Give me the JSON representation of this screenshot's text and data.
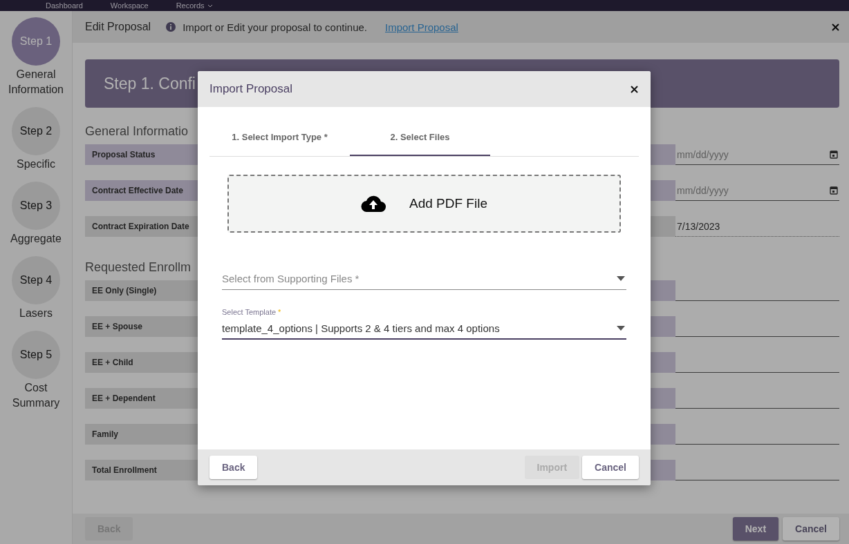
{
  "top_nav": {
    "items": [
      {
        "label": "Dashboard",
        "dropdown": false
      },
      {
        "label": "Workspace",
        "dropdown": false
      },
      {
        "label": "Records",
        "dropdown": true
      }
    ]
  },
  "steps": [
    {
      "label": "Step 1",
      "caption": "General Information",
      "selected": true
    },
    {
      "label": "Step 2",
      "caption": "Specific",
      "selected": false
    },
    {
      "label": "Step 3",
      "caption": "Aggregate",
      "selected": false
    },
    {
      "label": "Step 4",
      "caption": "Lasers",
      "selected": false
    },
    {
      "label": "Step 5",
      "caption": "Cost Summary",
      "selected": false
    }
  ],
  "header": {
    "title": "Edit Proposal",
    "message": "Import or Edit your proposal to continue.",
    "link": "Import Proposal"
  },
  "banner": {
    "title": "Step 1. Confi"
  },
  "sections": [
    {
      "heading": "General Informatio",
      "rows": [
        {
          "label": "Proposal Status",
          "readonly": false,
          "right_readonly": false,
          "right_field": {
            "kind": "date",
            "placeholder": "mm/dd/yyyy"
          }
        },
        {
          "label": "Contract Effective Date",
          "readonly": false,
          "right_readonly": false,
          "right_field": {
            "kind": "date",
            "placeholder": "mm/dd/yyyy"
          }
        },
        {
          "label": "Contract Expiration Date",
          "readonly": true,
          "right_readonly": true,
          "right_field": {
            "kind": "readonly",
            "value": "7/13/2023"
          }
        }
      ]
    },
    {
      "heading": "Requested Enrollm",
      "rows": [
        {
          "label": "EE Only (Single)",
          "readonly": true,
          "right_readonly": false,
          "right_field": {
            "kind": "text"
          }
        },
        {
          "label": "EE + Spouse",
          "readonly": true,
          "right_readonly": false,
          "right_field": {
            "kind": "text"
          }
        },
        {
          "label": "EE + Child",
          "readonly": true,
          "right_readonly": false,
          "right_field": {
            "kind": "text"
          }
        },
        {
          "label": "EE + Dependent",
          "readonly": true,
          "right_readonly": false,
          "right_field": {
            "kind": "text"
          }
        },
        {
          "label": "Family",
          "readonly": true,
          "right_readonly": false,
          "right_field": {
            "kind": "text"
          }
        },
        {
          "label": "Total Enrollment",
          "readonly": true,
          "right_readonly": false,
          "right_field": {
            "kind": "text"
          }
        }
      ]
    }
  ],
  "footer": {
    "buttons": [
      {
        "label": "Back",
        "kind": "secondary",
        "disabled": true
      },
      {
        "label": "Next",
        "kind": "primary",
        "disabled": false
      },
      {
        "label": "Cancel",
        "kind": "secondary",
        "disabled": false
      }
    ]
  },
  "modal": {
    "title": "Import Proposal",
    "tabs": [
      {
        "label": "1. Select Import Type *",
        "selected": false
      },
      {
        "label": "2. Select Files",
        "selected": true
      }
    ],
    "upload": {
      "label": "Add PDF File"
    },
    "supporting_files": {
      "placeholder": "Select from Supporting Files *"
    },
    "template": {
      "label": "Select Template",
      "required_mark": "*",
      "value": "template_4_options | Supports 2 & 4 tiers and max 4 options"
    },
    "buttons": [
      {
        "label": "Back",
        "kind": "left",
        "disabled": false
      },
      {
        "label": "Import",
        "kind": "right",
        "disabled": true
      },
      {
        "label": "Cancel",
        "kind": "right",
        "disabled": false
      }
    ]
  }
}
